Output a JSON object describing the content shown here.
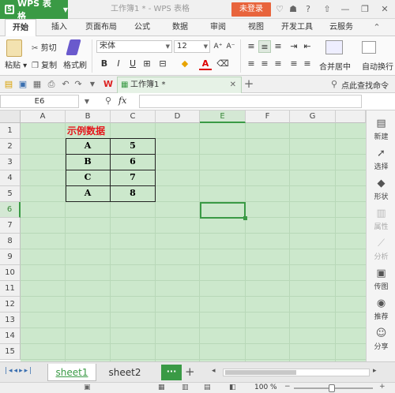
{
  "app": {
    "name": "WPS 表格",
    "doc_title": "工作簿1 * - WPS 表格",
    "login_label": "未登录"
  },
  "menu": [
    "开始",
    "插入",
    "页面布局",
    "公式",
    "数据",
    "审阅",
    "视图",
    "开发工具",
    "云服务"
  ],
  "ribbon": {
    "paste": "粘贴",
    "cut": "剪切",
    "copy": "复制",
    "format_painter": "格式刷",
    "font_name": "宋体",
    "font_size": "12",
    "bold": "B",
    "italic": "I",
    "underline": "U",
    "merge": "合并居中",
    "autowrap": "自动换行"
  },
  "tabbar": {
    "doc_tab": "工作簿1 *",
    "search": "点此查找命令"
  },
  "formula": {
    "cell_ref": "E6",
    "fx": "fx",
    "value": ""
  },
  "grid": {
    "columns": [
      "A",
      "B",
      "C",
      "D",
      "E",
      "F",
      "G"
    ],
    "rows": [
      "1",
      "2",
      "3",
      "4",
      "5",
      "6",
      "7",
      "8",
      "9",
      "10",
      "11",
      "12",
      "13",
      "14",
      "15"
    ],
    "selected_cell": "E6",
    "title_cell": "示例数据",
    "table": [
      [
        "A",
        "5"
      ],
      [
        "B",
        "6"
      ],
      [
        "C",
        "7"
      ],
      [
        "A",
        "8"
      ]
    ],
    "colors": {
      "title": "#e6151b",
      "grid_bg": "#cce8cc",
      "accent": "#3a9a45"
    }
  },
  "right_panel": [
    "新建",
    "选择",
    "形状",
    "属性",
    "分析",
    "传图",
    "推荐",
    "分享"
  ],
  "sheets": [
    "sheet1",
    "sheet2"
  ],
  "status": {
    "zoom": "100 %"
  }
}
